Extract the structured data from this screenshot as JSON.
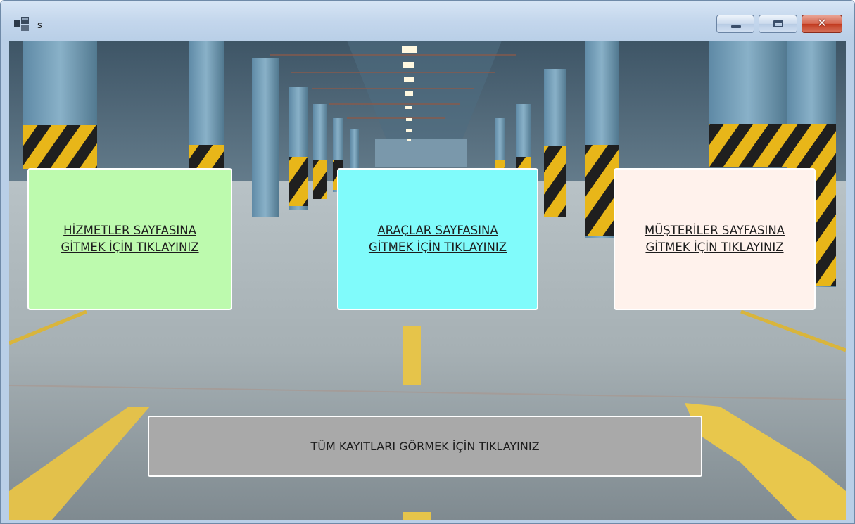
{
  "window": {
    "title": "s"
  },
  "cards": {
    "hizmetler": "HİZMETLER SAYFASINA\nGİTMEK İÇİN TIKLAYINIZ",
    "araclar": "ARAÇLAR SAYFASINA\nGİTMEK İÇİN TIKLAYINIZ",
    "musteriler": "MÜŞTERİLER SAYFASINA\nGİTMEK İÇİN TIKLAYINIZ"
  },
  "buttons": {
    "all_records": "TÜM KAYITLARI GÖRMEK İÇİN TIKLAYINIZ"
  },
  "colors": {
    "hizmetler_bg": "#bdfaae",
    "araclar_bg": "#80fbfb",
    "musteriler_bg": "#fff2ec",
    "all_records_bg": "#a9a9a9",
    "close_button": "#c9442a"
  },
  "icons": {
    "app": "app-window-icon",
    "minimize": "minimize-icon",
    "maximize": "maximize-icon",
    "close": "close-icon"
  },
  "background_image": "parking-garage-photo"
}
